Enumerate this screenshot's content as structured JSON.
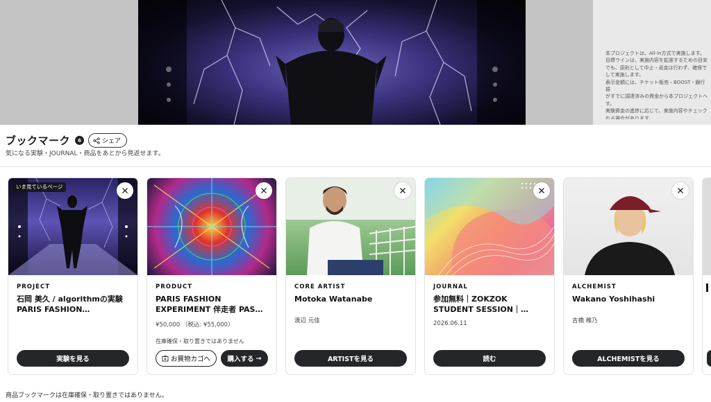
{
  "backdrop": {
    "side_text": "本プロジェクトは、All-in方式で実施します。\n目標ラインは、実施内容を拡張するための目安\nでも、原則として中止・返金は行わず、確保で\nして実施します。\n表示金額には、チケット販売・BOOST・銀行振\nがすでに調達済みの資金から本プロジェクトへ\nす。\n実験資金の進捗に応じて、実施内容やチェック\nれる場合があります。"
  },
  "bookmarks": {
    "title": "ブックマーク",
    "count": "6",
    "share_label": "シェア",
    "subtitle": "気になる実験・JOURNAL・商品をあとから見返せます。",
    "footer_note": "商品ブックマークは在庫確保・取り置きではありません。"
  },
  "cards": [
    {
      "now_label": "いま見ているページ",
      "kind": "PROJECT",
      "name": "石岡 美久 / algorithmの実験 PARIS FASHION…",
      "meta": "",
      "button": "実験を見る"
    },
    {
      "kind": "PRODUCT",
      "name": "PARIS FASHION EXPERIMENT 伴走者 PAS…",
      "meta": "¥50,000 （税込: ¥55,000）",
      "note": "在庫確保・取り置きではありません",
      "cart_button": "お買物カゴへ",
      "buy_button": "購入する",
      "buy_arrow": "→"
    },
    {
      "kind": "CORE ARTIST",
      "name": "Motoka Watanabe",
      "meta": "渡辺 元佳",
      "button": "ARTISTを見る"
    },
    {
      "kind": "JOURNAL",
      "name": "参加無料｜ZOKZOK STUDENT SESSION｜…",
      "meta": "2026.06.11",
      "button": "読む"
    },
    {
      "kind": "ALCHEMIST",
      "name": "Wakano Yoshihashi",
      "meta": "吉橋 稚乃",
      "button": "ALCHEMISTを見る"
    }
  ],
  "colors": {
    "button_dark": "#25262a",
    "backdrop_grey": "#c4c4c4",
    "border": "#e2e2e2"
  },
  "icons": [
    "close-icon",
    "share-icon",
    "cart-icon",
    "arrow-right-icon"
  ]
}
